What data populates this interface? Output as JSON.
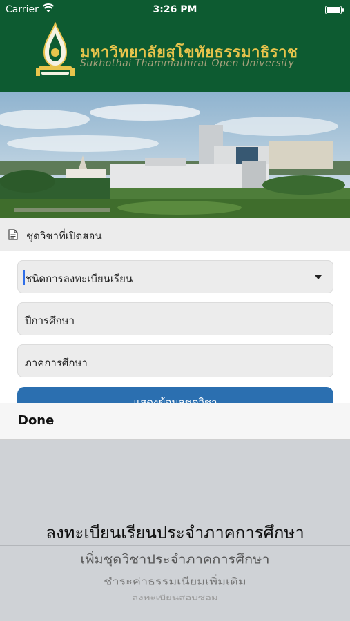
{
  "status_bar": {
    "carrier": "Carrier",
    "time": "3:26 PM"
  },
  "header": {
    "university_thai": "มหาวิทยาลัยสุโขทัยธรรมาธิราช",
    "university_en": "Sukhothai Thammathirat Open University"
  },
  "section": {
    "title": "ชุดวิชาที่เปิดสอน"
  },
  "form": {
    "registration_type": "ชนิดการลงทะเบียนเรียน",
    "academic_year": "ปีการศึกษา",
    "semester": "ภาคการศึกษา",
    "show_button": "แสดงข้อมูลชุดวิชา"
  },
  "picker": {
    "done_label": "Done",
    "options": [
      "ลงทะเบียนเรียนประจำภาคการศึกษา",
      "เพิ่มชุดวิชาประจำภาคการศึกษา",
      "ชำระค่าธรรมเนียมเพิ่มเติม",
      "ลงทะเบียนสอบซ่อม"
    ]
  },
  "colors": {
    "header_green": "#0d5b31",
    "accent_gold": "#e8c44c",
    "button_blue": "#2b6fb0"
  }
}
